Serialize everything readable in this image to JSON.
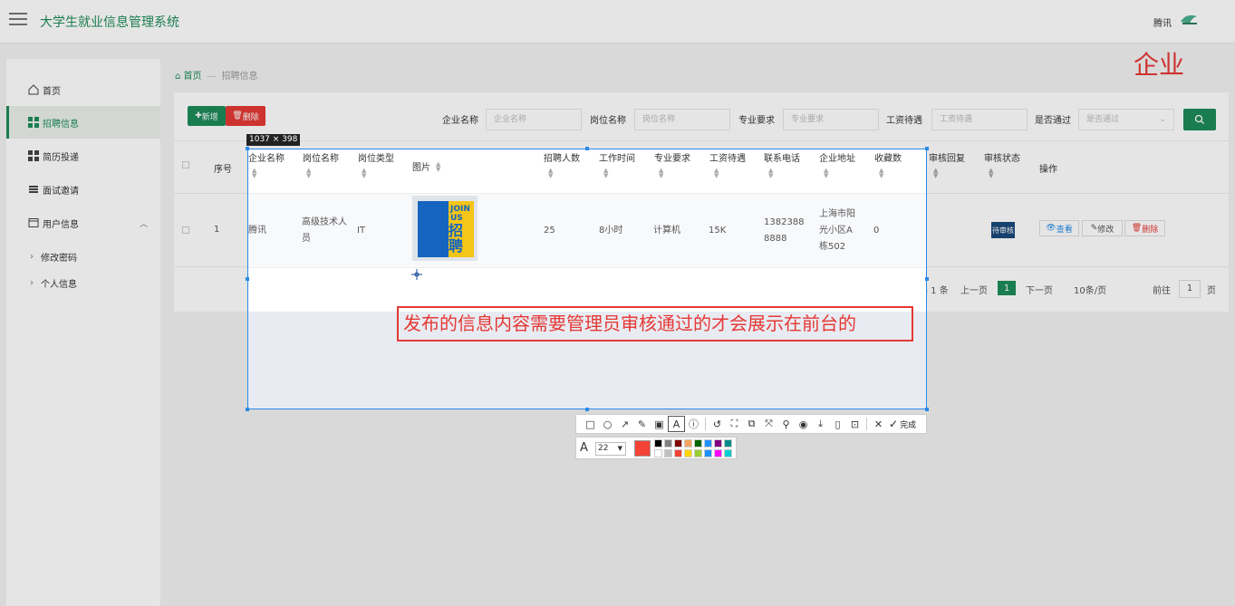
{
  "header": {
    "app_title": "大学生就业信息管理系统",
    "user_name": "腾讯"
  },
  "sidebar": {
    "items": [
      {
        "label": "首页"
      },
      {
        "label": "招聘信息"
      },
      {
        "label": "简历投递"
      },
      {
        "label": "面试邀请"
      },
      {
        "label": "用户信息"
      }
    ],
    "sub_items": [
      {
        "label": "修改密码"
      },
      {
        "label": "个人信息"
      }
    ]
  },
  "breadcrumb": {
    "home": "首页",
    "current": "招聘信息"
  },
  "watermark": "企业",
  "toolbar": {
    "add_label": "新增",
    "delete_label": "删除"
  },
  "filters": [
    {
      "label": "企业名称",
      "placeholder": "企业名称"
    },
    {
      "label": "岗位名称",
      "placeholder": "岗位名称"
    },
    {
      "label": "专业要求",
      "placeholder": "专业要求"
    },
    {
      "label": "工资待遇",
      "placeholder": "工资待遇"
    },
    {
      "label": "是否通过",
      "placeholder": "是否通过"
    }
  ],
  "table": {
    "headers": [
      "序号",
      "企业名称",
      "岗位名称",
      "岗位类型",
      "图片",
      "招聘人数",
      "工作时间",
      "专业要求",
      "工资待遇",
      "联系电话",
      "企业地址",
      "收藏数",
      "审核回复",
      "审核状态",
      "操作"
    ],
    "rows": [
      {
        "index": "1",
        "company": "腾讯",
        "position": "高级技术人员",
        "type": "IT",
        "recruit_count": "25",
        "work_time": "8小时",
        "major": "计算机",
        "salary": "15K",
        "phone": "13823888888",
        "address": "上海市阳光小区A栋502",
        "favorites": "0",
        "status": "待审核"
      }
    ],
    "actions": {
      "view": "查看",
      "edit": "修改",
      "delete": "删除"
    }
  },
  "poster": {
    "top_text": "JOIN US",
    "big_text": "招聘"
  },
  "pagination": {
    "total": "共 1 条",
    "prev": "上一页",
    "current": "1",
    "next": "下一页",
    "page_size": "10条/页",
    "goto_label": "前往",
    "goto_value": "1",
    "page_unit": "页"
  },
  "screenshot_tool": {
    "size_label": "1037 × 398",
    "annotation_text": "发布的信息内容需要管理员审核通过的才会展示在前台的",
    "done_label": "完成",
    "font_size": "22",
    "current_color": "#f44336",
    "palette": [
      "#000000",
      "#808080",
      "#800000",
      "#f4a460",
      "#006400",
      "#1e90ff",
      "#800080",
      "#008b8b",
      "#ffffff",
      "#c0c0c0",
      "#f44336",
      "#ffd700",
      "#9acd32",
      "#1e90ff",
      "#ff00ff",
      "#00ced1"
    ]
  },
  "colors": {
    "accent": "#1e8c5a",
    "danger": "#e53935",
    "capture_border": "#2b8ae8"
  }
}
